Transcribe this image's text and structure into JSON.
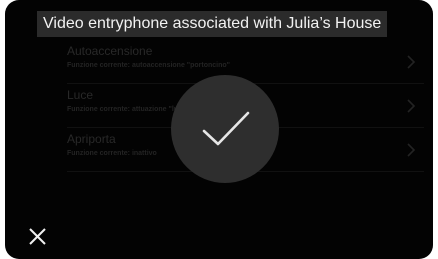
{
  "header": {
    "title": "Video entryphone associated with Julia’s House"
  },
  "settings": [
    {
      "label": "Autoaccensione",
      "current": "Funzione corrente: autoaccensione \"portoncino\"",
      "icon": "chevron-right-icon"
    },
    {
      "label": "Luce",
      "current": "Funzione corrente: attuazione \"luce piccola\"",
      "icon": "chevron-right-icon"
    },
    {
      "label": "Apriporta",
      "current": "Funzione corrente: inattivo",
      "icon": "chevron-right-icon"
    }
  ],
  "confirmation": {
    "icon": "checkmark-icon"
  },
  "footer": {
    "close_icon": "close-icon"
  },
  "colors": {
    "background": "#040404",
    "title_pill": "#2b2b2b",
    "confirmation_circle": "#2e2e2e",
    "foreground": "#f2f2f2"
  }
}
